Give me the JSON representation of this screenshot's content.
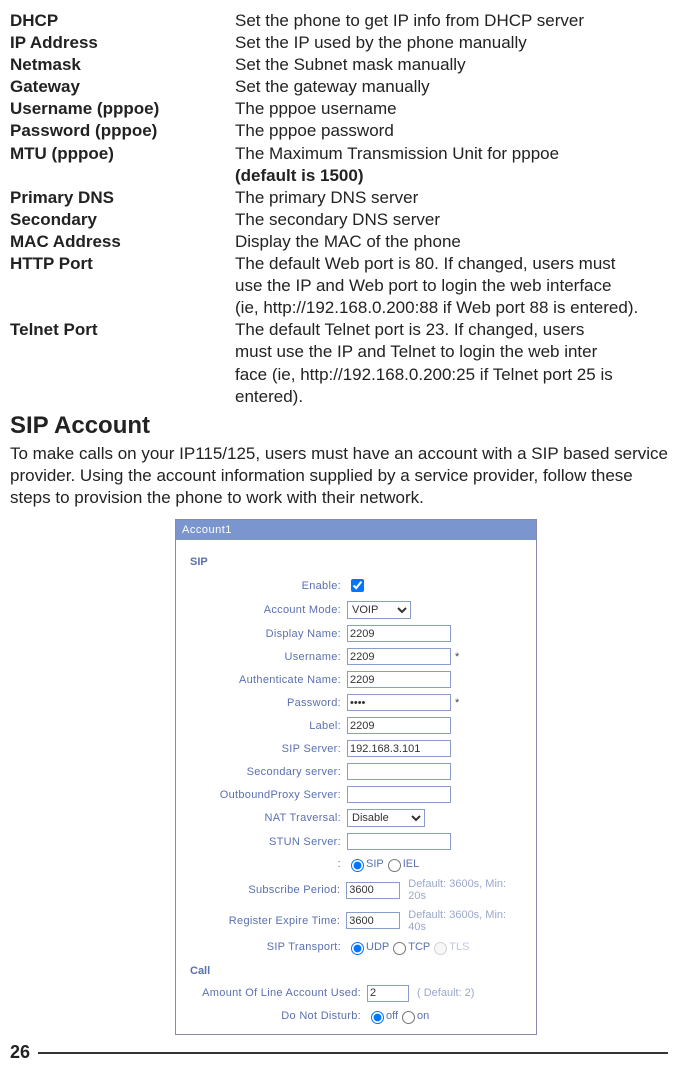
{
  "defs": [
    {
      "term": "DHCP",
      "desc": "Set the phone to get IP info from DHCP server"
    },
    {
      "term": "IP Address",
      "desc": "Set the IP used by the phone manually"
    },
    {
      "term": "Netmask",
      "desc": "Set the Subnet mask manually"
    },
    {
      "term": "Gateway",
      "desc": "Set the gateway manually"
    },
    {
      "term": " Username (pppoe)",
      "desc": "The pppoe username"
    },
    {
      "term": "Password (pppoe)",
      "desc": "The pppoe password"
    },
    {
      "term": "MTU (pppoe)",
      "desc": "The Maximum Transmission Unit for pppoe"
    },
    {
      "term": "",
      "desc": "(default is 1500)",
      "bold": true
    },
    {
      "term": "Primary DNS",
      "desc": "The primary DNS server"
    },
    {
      "term": "Secondary",
      "desc": "The secondary DNS server"
    },
    {
      "term": "MAC Address",
      "desc": "Display the MAC of the phone"
    },
    {
      "term": "HTTP Port",
      "desc": "The default Web port is 80.  If changed, users must"
    },
    {
      "term": "",
      "desc": "use the IP and Web port to login the web interface"
    },
    {
      "term": "",
      "desc": "(ie, http://192.168.0.200:88 if Web port 88 is entered)."
    },
    {
      "term": "Telnet Port",
      "desc": "The default Telnet port is 23.  If changed, users "
    },
    {
      "term": "",
      "desc": "must use the IP and Telnet to login the web inter"
    },
    {
      "term": "",
      "desc": "face (ie,  http://192.168.0.200:25 if Telnet port 25 is"
    },
    {
      "term": "",
      "desc": "entered)."
    }
  ],
  "heading": "SIP Account",
  "intro": "To make calls on your IP115/125, users must have an account with a SIP based service provider.  Using the account information supplied by a service provider, follow these steps to provision the phone to work with their network. ",
  "ss": {
    "title": "Account1",
    "sip": "SIP",
    "rows": {
      "enable": "Enable:",
      "acctmode": "Account Mode:",
      "acctmode_val": "VOIP",
      "dispname": "Display Name:",
      "dispname_val": "2209",
      "username": "Username:",
      "username_val": "2209",
      "authname": "Authenticate Name:",
      "authname_val": "2209",
      "password": "Password:",
      "password_val": "••••",
      "label": "Label:",
      "label_val": "2209",
      "sipserver": "SIP Server:",
      "sipserver_val": "192.168.3.101",
      "secserver": "Secondary server:",
      "outproxy": "OutboundProxy Server:",
      "nat": "NAT Traversal:",
      "nat_val": "Disable",
      "stun": "STUN Server:",
      "proto_empty": ":",
      "sip_radio": "SIP",
      "iel_radio": "IEL",
      "subperiod": "Subscribe Period:",
      "subperiod_val": "3600",
      "subperiod_hint": "Default: 3600s, Min:  20s",
      "regexpire": "Register Expire Time:",
      "regexpire_val": "3600",
      "regexpire_hint": "Default: 3600s, Min:  40s",
      "siptransport": "SIP Transport:",
      "udp": "UDP",
      "tcp": "TCP",
      "tls": "TLS",
      "call": "Call",
      "amount": "Amount Of Line Account Used:",
      "amount_val": "2",
      "amount_hint": "( Default: 2)",
      "dnd": "Do Not Disturb:",
      "off": "off",
      "on": "on"
    }
  },
  "page": "26"
}
